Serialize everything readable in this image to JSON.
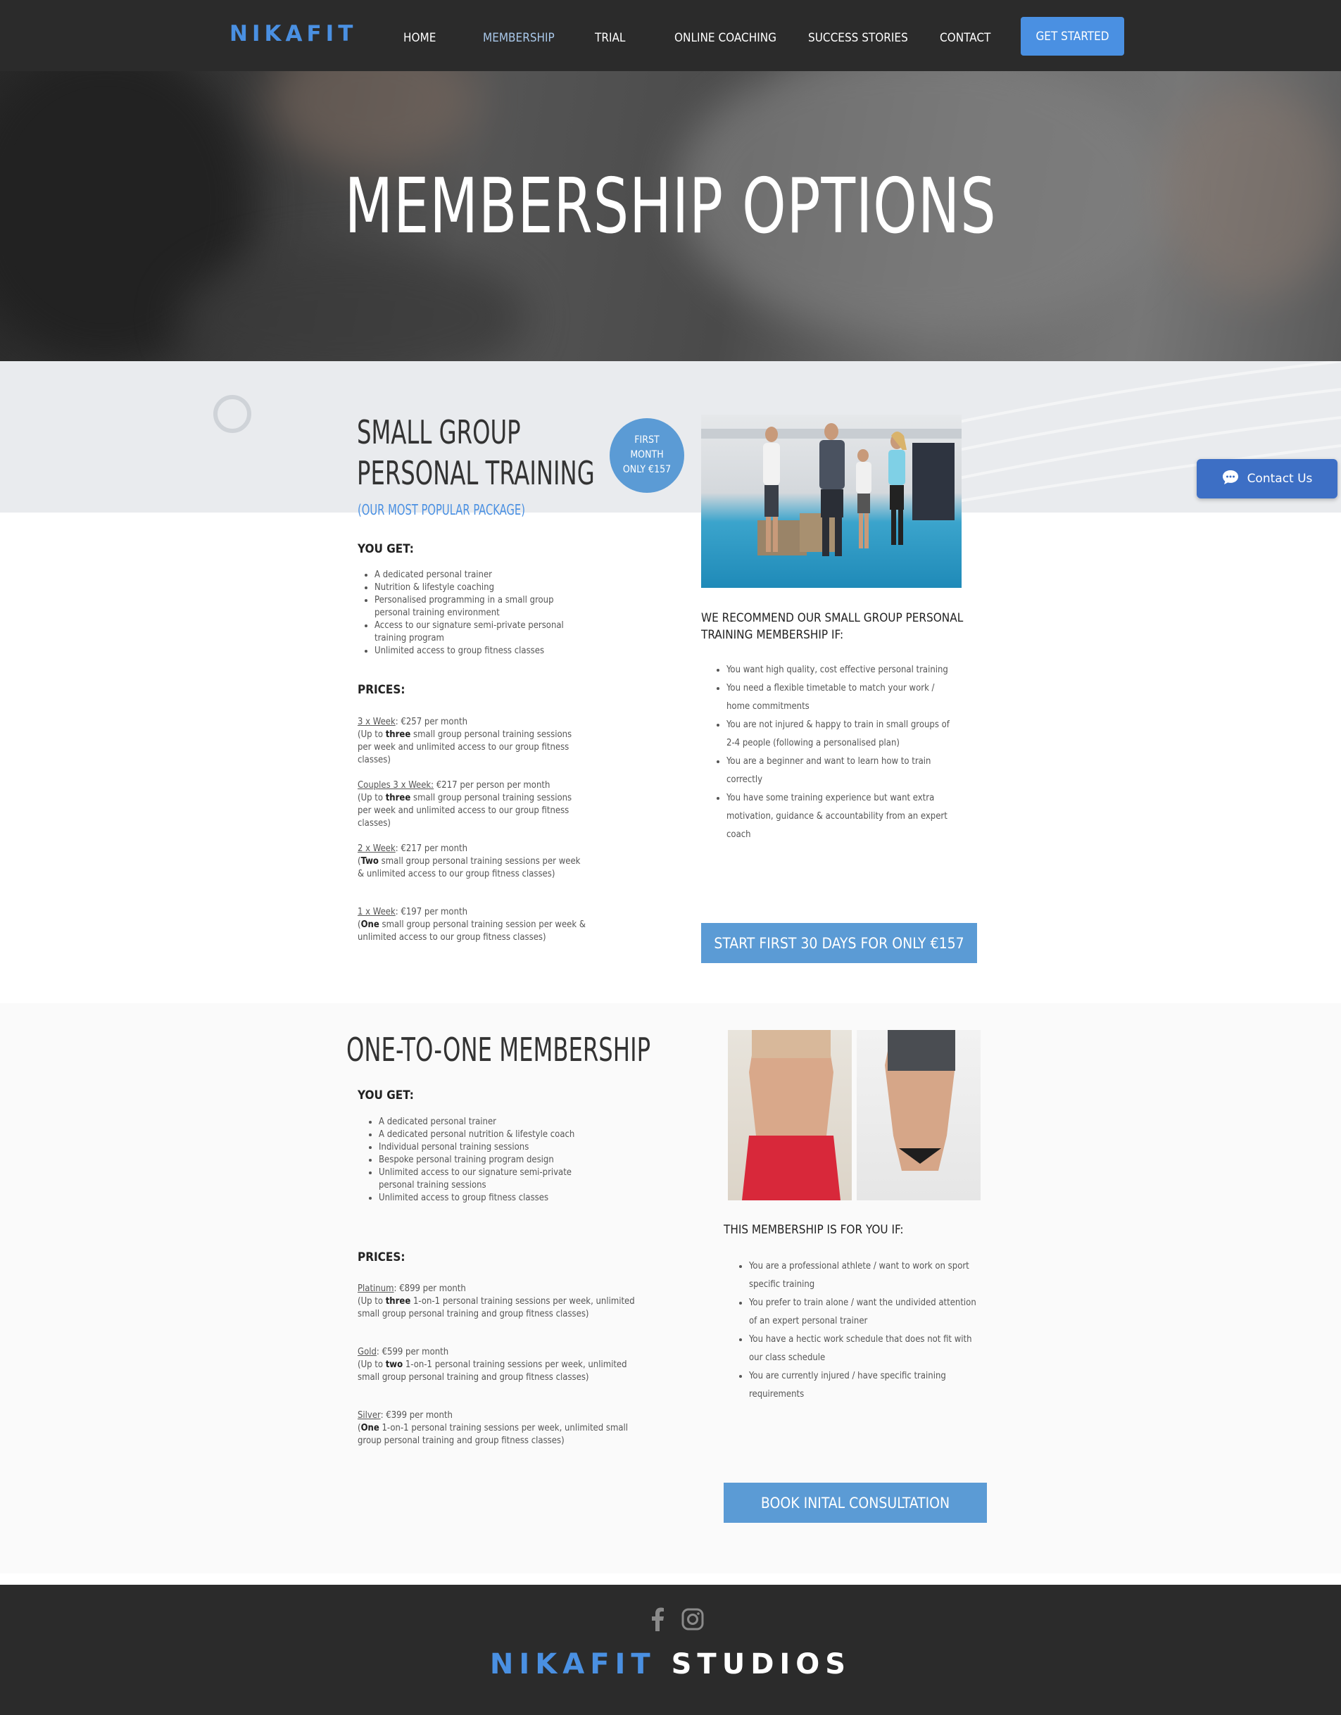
{
  "nav": {
    "logo": "NIKAFIT",
    "items": [
      "HOME",
      "MEMBERSHIP",
      "TRIAL",
      "ONLINE COACHING",
      "SUCCESS STORIES",
      "CONTACT"
    ],
    "active": "MEMBERSHIP",
    "cta": "GET STARTED"
  },
  "hero": {
    "title": "MEMBERSHIP OPTIONS"
  },
  "small_group": {
    "title_line1": "SMALL GROUP",
    "title_line2": "PERSONAL TRAINING",
    "subtitle": "(OUR MOST POPULAR PACKAGE)",
    "badge_line1": "FIRST",
    "badge_line2": "MONTH",
    "badge_line3": "ONLY €157",
    "you_get_label": "YOU GET:",
    "you_get": [
      "A dedicated personal trainer",
      "Nutrition & lifestyle coaching",
      "Personalised programming in a small group personal training environment",
      "Access to our signature semi-private personal training program",
      "Unlimited access to group fitness classes"
    ],
    "prices_label": "PRICES:",
    "prices": [
      {
        "name": "3 x Week",
        "sep": ": ",
        "price": "€257 per month",
        "pre": "(Up to ",
        "bold": "three",
        "post": " small group personal training sessions per week and unlimited access to our group fitness classes)"
      },
      {
        "name": "Couples 3 x Week:",
        "sep": " ",
        "price": "€217 per person per month",
        "pre": "(Up to ",
        "bold": "three",
        "post": " small group personal training sessions per week and unlimited access to our group fitness classes)"
      },
      {
        "name": "2 x Week",
        "sep": ": ",
        "price": "€217 per month",
        "pre": "(",
        "bold": "Two",
        "post": " small group personal training sessions per week & unlimited access to our group fitness classes)"
      },
      {
        "name": "1 x Week",
        "sep": ": ",
        "price": "€197 per month",
        "pre": "(",
        "bold": "One",
        "post": " small group personal training session per week & unlimited access to our group fitness classes)"
      }
    ],
    "recommend_line1": "WE RECOMMEND OUR SMALL GROUP PERSONAL",
    "recommend_line2": "TRAINING MEMBERSHIP IF:",
    "recommend": [
      "You want high quality, cost effective personal training",
      "You need a flexible timetable to match your work / home commitments",
      "You are not injured & happy to train in small groups of 2-4 people (following a personalised plan)",
      "You are a beginner and want to learn how to train correctly",
      "You have some training experience but want extra motivation, guidance & accountability from an expert coach"
    ],
    "button": "START FIRST 30 DAYS FOR ONLY €157"
  },
  "one_to_one": {
    "title": "ONE-TO-ONE MEMBERSHIP",
    "you_get_label": "YOU GET:",
    "you_get": [
      "A dedicated personal trainer",
      "A dedicated personal nutrition & lifestyle coach",
      "Individual personal training sessions",
      "Bespoke personal training program design",
      "Unlimited access to our signature semi-private personal training sessions",
      "Unlimited access to group fitness classes"
    ],
    "prices_label": "PRICES:",
    "prices": [
      {
        "name": "Platinum",
        "price": "€899 per month",
        "pre": "(Up to ",
        "bold": "three",
        "post": " 1-on-1 personal training sessions per week, unlimited small group personal training and group fitness classes)"
      },
      {
        "name": "Gold",
        "price": "€599 per month",
        "pre": "(Up to ",
        "bold": "two",
        "post": " 1-on-1 personal training sessions per week, unlimited small group personal training and group fitness classes)"
      },
      {
        "name": "Silver",
        "price": "€399 per month",
        "pre": "(",
        "bold": "One",
        "post": " 1-on-1 personal training sessions per week, unlimited small group personal training and group fitness classes)"
      }
    ],
    "for_you_label": "THIS MEMBERSHIP IS FOR YOU IF:",
    "for_you": [
      "You are a professional athlete / want to work on sport specific training",
      "You prefer to train alone / want the undivided attention of an expert personal trainer",
      "You have a hectic work schedule that does not fit with our class schedule",
      "You are currently injured / have specific training requirements"
    ],
    "button": "BOOK INITAL CONSULTATION"
  },
  "contact_widget": {
    "label": "Contact Us"
  },
  "footer": {
    "logo_a": "NIKAFIT",
    "logo_b": "STUDIOS",
    "icons": [
      "facebook-icon",
      "instagram-icon"
    ]
  },
  "colors": {
    "brand_blue": "#4a90e2",
    "button_blue": "#5b9bd5",
    "dark": "#2b2b2b"
  }
}
